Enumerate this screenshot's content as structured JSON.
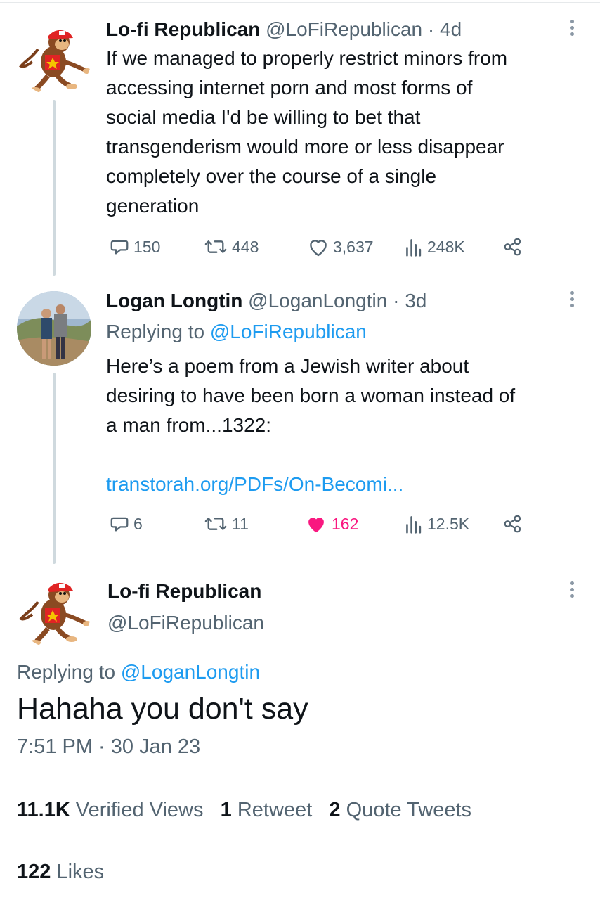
{
  "colors": {
    "link": "#1d9bf0",
    "muted": "#536471",
    "like": "#f91880",
    "line": "#cfd9de"
  },
  "tweet1": {
    "name": "Lo-fi Republican",
    "handle": "@LoFiRepublican",
    "sep": "·",
    "time": "4d",
    "text_lines": [
      "If we managed to properly restrict minors from",
      "accessing internet porn and most forms of",
      "social media I'd be willing to bet that",
      "transgenderism would more or less disappear",
      "completely over the course of a single",
      "generation"
    ],
    "replies": "150",
    "retweets": "448",
    "likes": "3,637",
    "views": "248K"
  },
  "tweet2": {
    "name": "Logan Longtin",
    "handle": "@LoganLongtin",
    "sep": "·",
    "time": "3d",
    "replying_prefix": "Replying to",
    "replying_to": "@LoFiRepublican",
    "text_lines": [
      "Here’s a poem from a Jewish writer about",
      "desiring to have been born a woman instead of",
      "a man from...1322:"
    ],
    "link": "transtorah.org/PDFs/On-Becomi...",
    "replies": "6",
    "retweets": "11",
    "likes": "162",
    "views": "12.5K"
  },
  "main": {
    "name": "Lo-fi Republican",
    "handle": "@LoFiRepublican",
    "replying_prefix": "Replying to",
    "replying_to": "@LoganLongtin",
    "text": "Hahaha you don't say",
    "timestamp": "7:51 PM · 30 Jan 23",
    "verified_views_count": "11.1K",
    "verified_views_label": "Verified Views",
    "retweets_count": "1",
    "retweets_label": "Retweet",
    "quotes_count": "2",
    "quotes_label": "Quote Tweets",
    "likes_count": "122",
    "likes_label": "Likes"
  },
  "icons": {
    "avatar1": "monkey-avatar",
    "avatar2": "couple-photo-avatar",
    "reply": "reply-icon",
    "retweet": "retweet-icon",
    "like": "heart-icon",
    "views": "views-icon",
    "share": "share-icon",
    "more": "more-icon"
  }
}
